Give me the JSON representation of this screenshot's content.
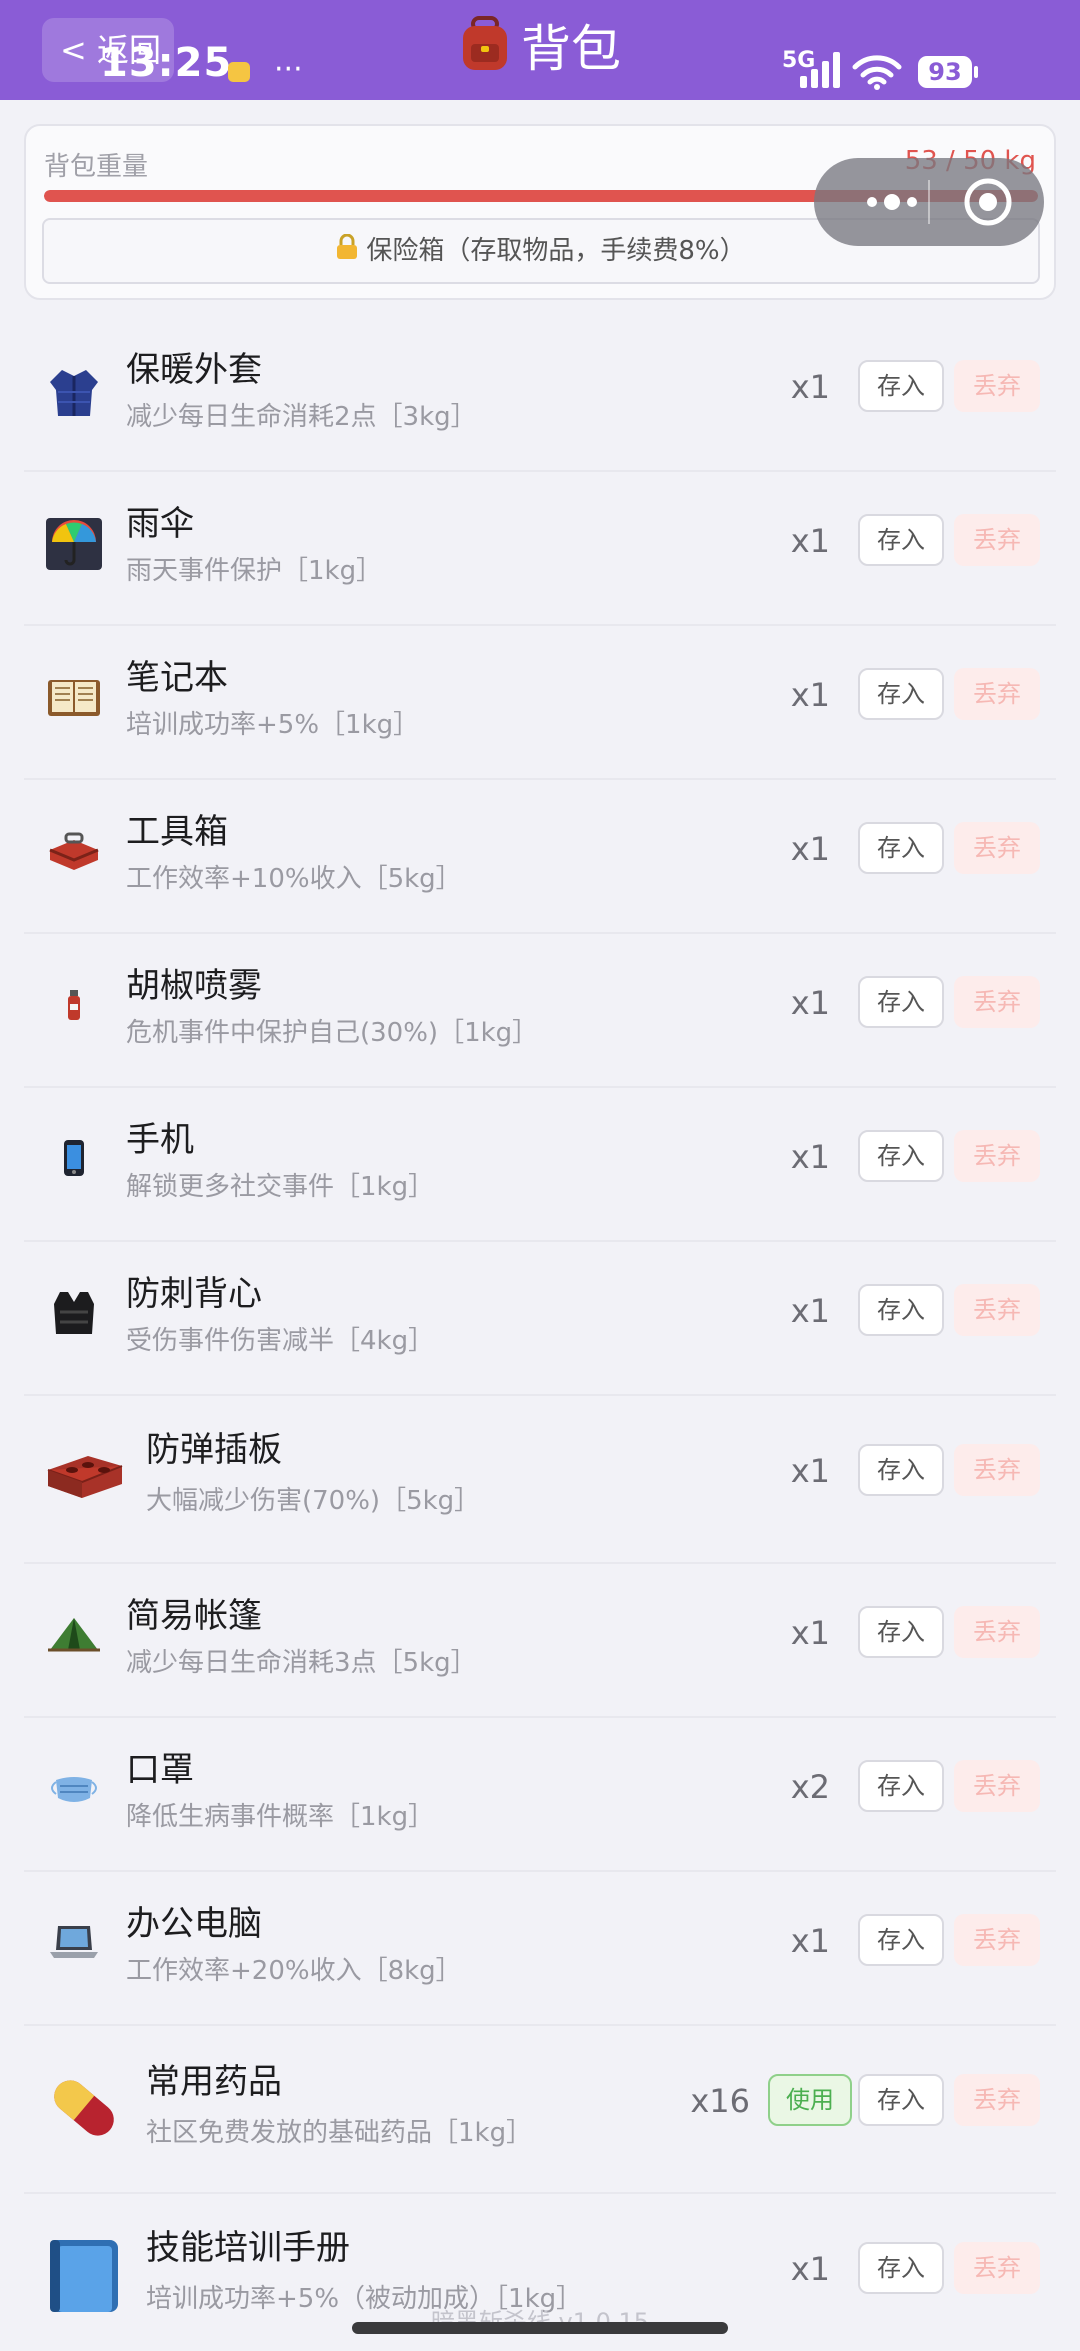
{
  "status_bar": {
    "time": "13:25",
    "dots": "···",
    "network": "5G",
    "battery": "93"
  },
  "header": {
    "back_label": "< 返回",
    "title": "背包",
    "title_icon": "backpack-icon",
    "bg_color": "#8a5cd6"
  },
  "weight": {
    "label": "背包重量",
    "value": "53 / 50 kg",
    "current": 53,
    "max": 50,
    "bar_color": "#e0544f"
  },
  "safe_box": {
    "label": "保险箱（存取物品，手续费8%）",
    "icon": "lock-icon"
  },
  "items": [
    {
      "name": "保暖外套",
      "desc": "减少每日生命消耗2点［3kg］",
      "qty": "x1",
      "icon": "jacket-icon",
      "store": "存入",
      "discard": "丢弃"
    },
    {
      "name": "雨伞",
      "desc": "雨天事件保护［1kg］",
      "qty": "x1",
      "icon": "umbrella-icon",
      "store": "存入",
      "discard": "丢弃"
    },
    {
      "name": "笔记本",
      "desc": "培训成功率+5%［1kg］",
      "qty": "x1",
      "icon": "notebook-icon",
      "store": "存入",
      "discard": "丢弃"
    },
    {
      "name": "工具箱",
      "desc": "工作效率+10%收入［5kg］",
      "qty": "x1",
      "icon": "toolbox-icon",
      "store": "存入",
      "discard": "丢弃"
    },
    {
      "name": "胡椒喷雾",
      "desc": "危机事件中保护自己(30%)［1kg］",
      "qty": "x1",
      "icon": "spray-icon",
      "store": "存入",
      "discard": "丢弃"
    },
    {
      "name": "手机",
      "desc": "解锁更多社交事件［1kg］",
      "qty": "x1",
      "icon": "phone-icon",
      "store": "存入",
      "discard": "丢弃"
    },
    {
      "name": "防刺背心",
      "desc": "受伤事件伤害减半［4kg］",
      "qty": "x1",
      "icon": "vest-icon",
      "store": "存入",
      "discard": "丢弃"
    },
    {
      "name": "防弹插板",
      "desc": "大幅减少伤害(70%)［5kg］",
      "qty": "x1",
      "icon": "brick-plate-icon",
      "store": "存入",
      "discard": "丢弃"
    },
    {
      "name": "简易帐篷",
      "desc": "减少每日生命消耗3点［5kg］",
      "qty": "x1",
      "icon": "tent-icon",
      "store": "存入",
      "discard": "丢弃"
    },
    {
      "name": "口罩",
      "desc": "降低生病事件概率［1kg］",
      "qty": "x2",
      "icon": "mask-icon",
      "store": "存入",
      "discard": "丢弃"
    },
    {
      "name": "办公电脑",
      "desc": "工作效率+20%收入［8kg］",
      "qty": "x1",
      "icon": "laptop-icon",
      "store": "存入",
      "discard": "丢弃"
    },
    {
      "name": "常用药品",
      "desc": "社区免费发放的基础药品［1kg］",
      "qty": "x16",
      "icon": "pill-icon",
      "use": "使用",
      "store": "存入",
      "discard": "丢弃"
    },
    {
      "name": "技能培训手册",
      "desc": "培训成功率+5%（被动加成）［1kg］",
      "qty": "x1",
      "icon": "manual-book-icon",
      "store": "存入",
      "discard": "丢弃"
    }
  ],
  "footer": {
    "version": "暗黑斩杀线 v1.0.15"
  }
}
